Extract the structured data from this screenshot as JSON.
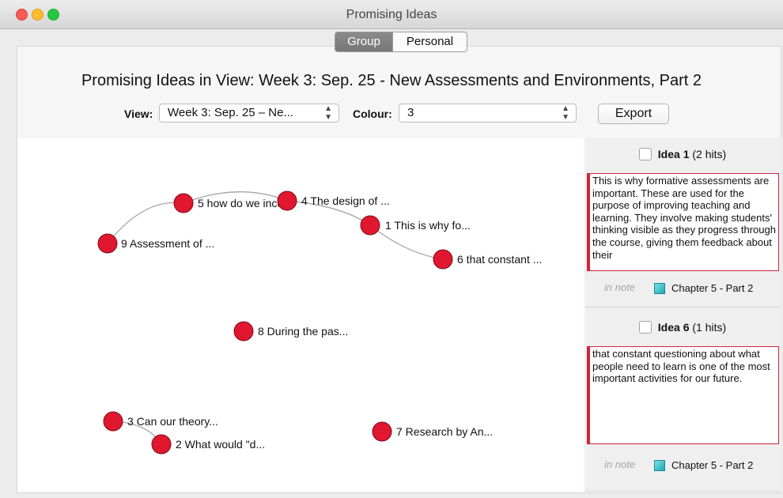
{
  "window": {
    "title": "Promising Ideas"
  },
  "tabs": [
    {
      "label": "Group",
      "active": true
    },
    {
      "label": "Personal",
      "active": false
    }
  ],
  "headline": "Promising Ideas in View: Week 3: Sep. 25 - New Assessments and Environments, Part 2",
  "controls": {
    "view_label": "View:",
    "view_value": "Week 3: Sep. 25 – Ne...",
    "colour_label": "Colour:",
    "colour_value": "3",
    "export_label": "Export"
  },
  "graph": {
    "node_color": "#e0172f",
    "nodes": [
      {
        "label": "9 Assessment of ..."
      },
      {
        "label": "5 how do we inco..."
      },
      {
        "label": "4 The design of ..."
      },
      {
        "label": "1 This is why fo..."
      },
      {
        "label": "6 that constant ..."
      },
      {
        "label": "8 During the pas..."
      },
      {
        "label": "3 Can our theory..."
      },
      {
        "label": "2 What would  \"d..."
      },
      {
        "label": "7 Research by An..."
      }
    ]
  },
  "ideas": [
    {
      "checkbox": false,
      "title": "Idea 1",
      "hits": "(2 hits)",
      "text": "This is why formative assessments are important. These are used for the purpose of improving teaching and learning. They involve making students' thinking visible as they progress through the course, giving them feedback about their",
      "in_note_label": "in note",
      "note": "Chapter 5 - Part 2"
    },
    {
      "checkbox": false,
      "title": "Idea 6",
      "hits": "(1 hits)",
      "text": "that constant questioning about what people need to learn is one of the most important activities for our future.",
      "in_note_label": "in note",
      "note": "Chapter 5 - Part 2"
    }
  ],
  "accent_color": "#d2233f"
}
